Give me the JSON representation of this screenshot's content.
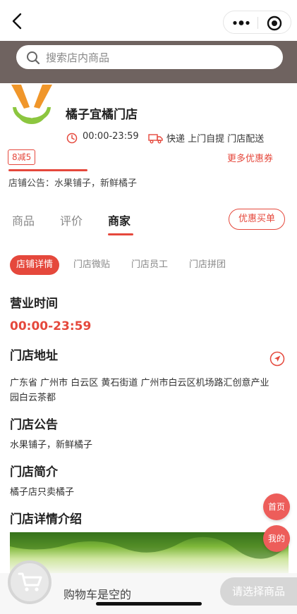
{
  "search": {
    "placeholder": "搜索店内商品"
  },
  "store": {
    "name": "橘子宜橘门店",
    "hours": "00:00-23:59",
    "delivery": "快递 上门自提 门店配送",
    "coupon_badge": "8减5",
    "more_coupons": "更多优惠券",
    "notice": "店铺公告：水果铺子，新鲜橘子"
  },
  "tabs": [
    {
      "label": "商品"
    },
    {
      "label": "评价"
    },
    {
      "label": "商家"
    }
  ],
  "offer_button": "优惠买单",
  "subtabs": [
    {
      "label": "店铺详情"
    },
    {
      "label": "门店微贴"
    },
    {
      "label": "门店员工"
    },
    {
      "label": "门店拼团"
    }
  ],
  "details": {
    "hours_title": "营业时间",
    "hours_value": "00:00-23:59",
    "address_title": "门店地址",
    "address_line1": "广东省 广州市 白云区 黄石街道 广州市白云区机场路汇创意产业",
    "address_line2": "园白云茶都",
    "notice_title": "门店公告",
    "notice_text": "水果铺子，新鲜橘子",
    "intro_title": "门店简介",
    "intro_text": "橘子店只卖橘子",
    "detail_intro_title": "门店详情介绍"
  },
  "float_buttons": {
    "home": "首页",
    "mine": "我的"
  },
  "cart": {
    "empty_text": "购物车是空的",
    "checkout": "请选择商品"
  },
  "colors": {
    "accent": "#e5483c",
    "header_band": "#6f6360",
    "logo_orange": "#f0962a",
    "logo_green": "#8cc63f"
  },
  "icons": [
    "back-icon",
    "more-icon",
    "target-icon",
    "search-icon",
    "clock-icon",
    "truck-icon",
    "navigation-icon",
    "cart-icon"
  ]
}
